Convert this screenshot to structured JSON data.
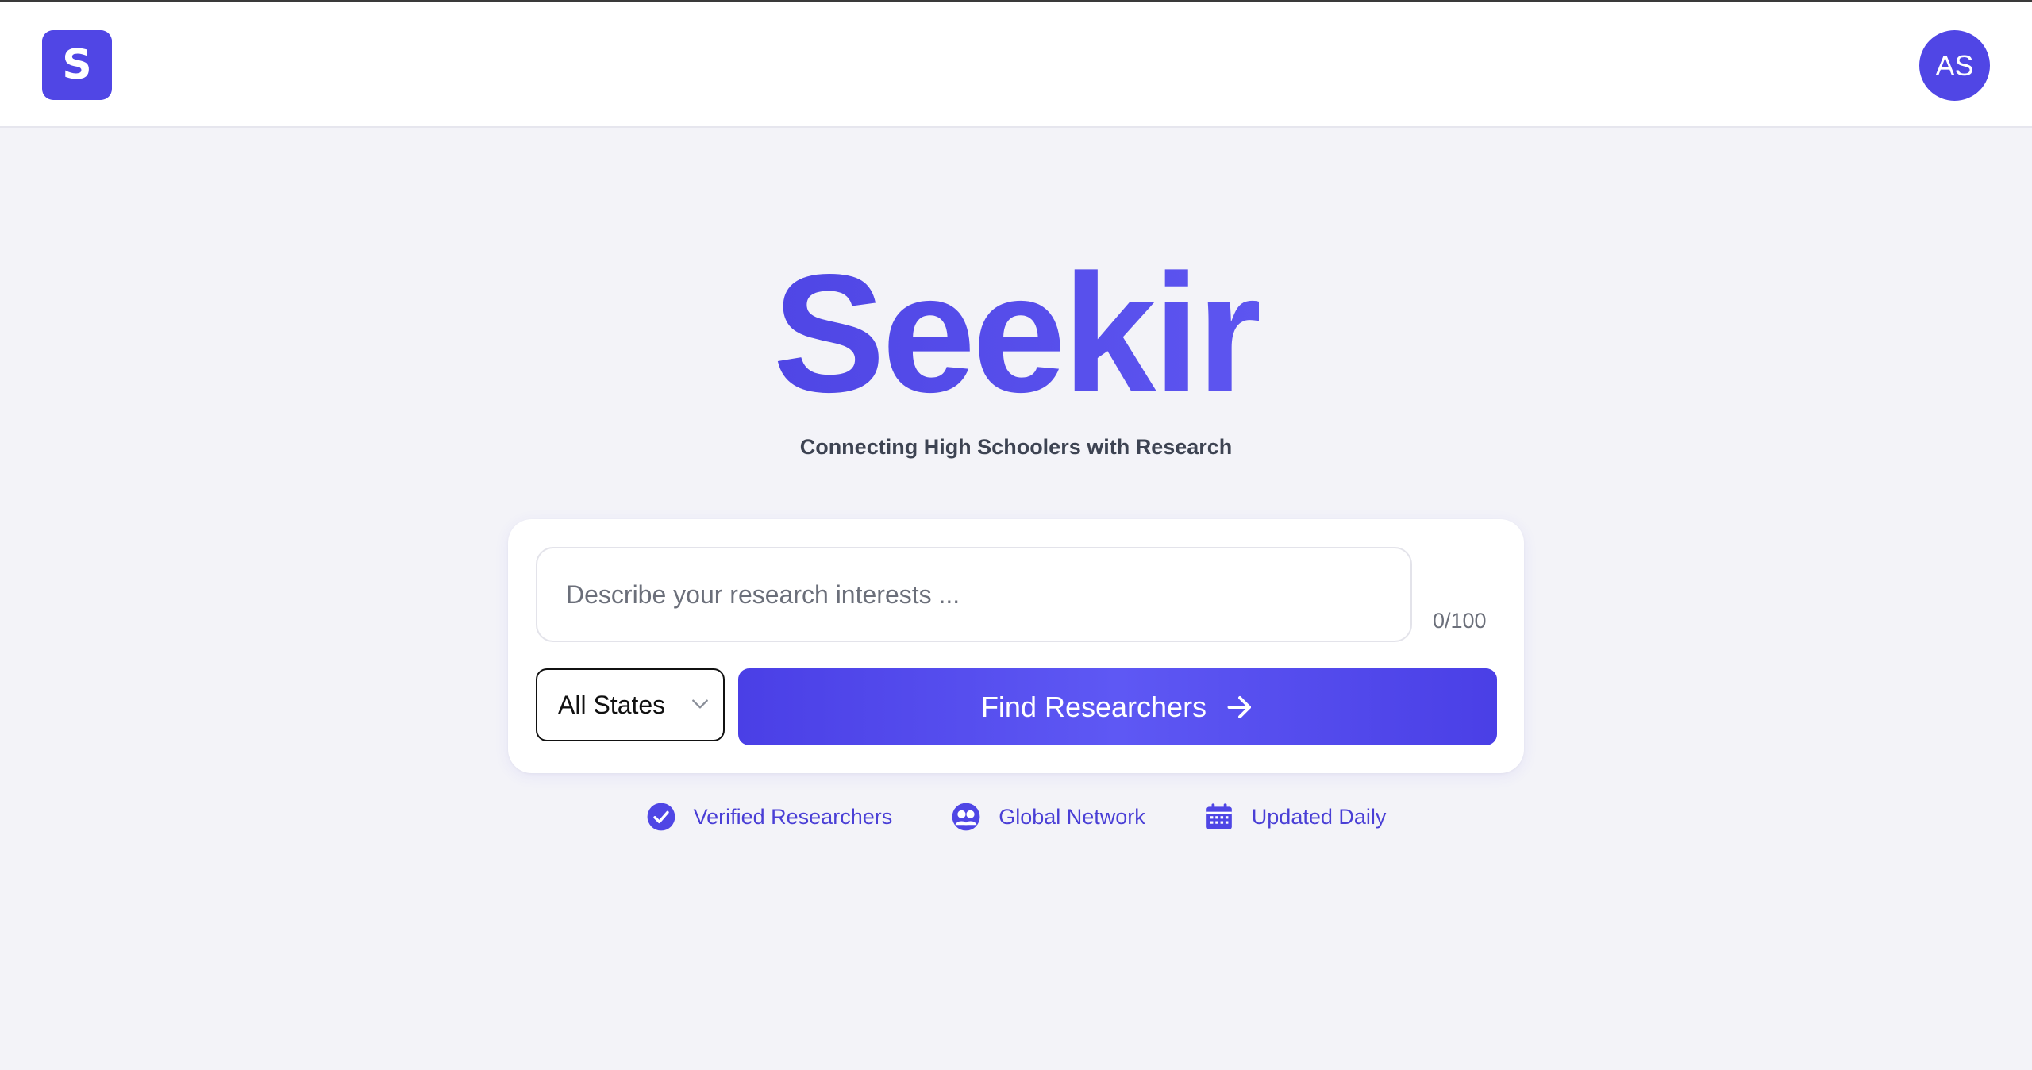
{
  "header": {
    "logo_letter": "S",
    "avatar_initials": "AS"
  },
  "hero": {
    "title": "Seekir",
    "subtitle": "Connecting High Schoolers with Research"
  },
  "search": {
    "placeholder": "Describe your research interests ...",
    "value": "",
    "char_count": "0/100",
    "state_selected": "All States",
    "submit_label": "Find Researchers"
  },
  "features": [
    {
      "label": "Verified Researchers",
      "icon": "check-circle-icon"
    },
    {
      "label": "Global Network",
      "icon": "people-icon"
    },
    {
      "label": "Updated Daily",
      "icon": "calendar-icon"
    }
  ],
  "colors": {
    "accent": "#5046e5",
    "background": "#f3f3f8",
    "feature_text": "#4a3fd6"
  }
}
